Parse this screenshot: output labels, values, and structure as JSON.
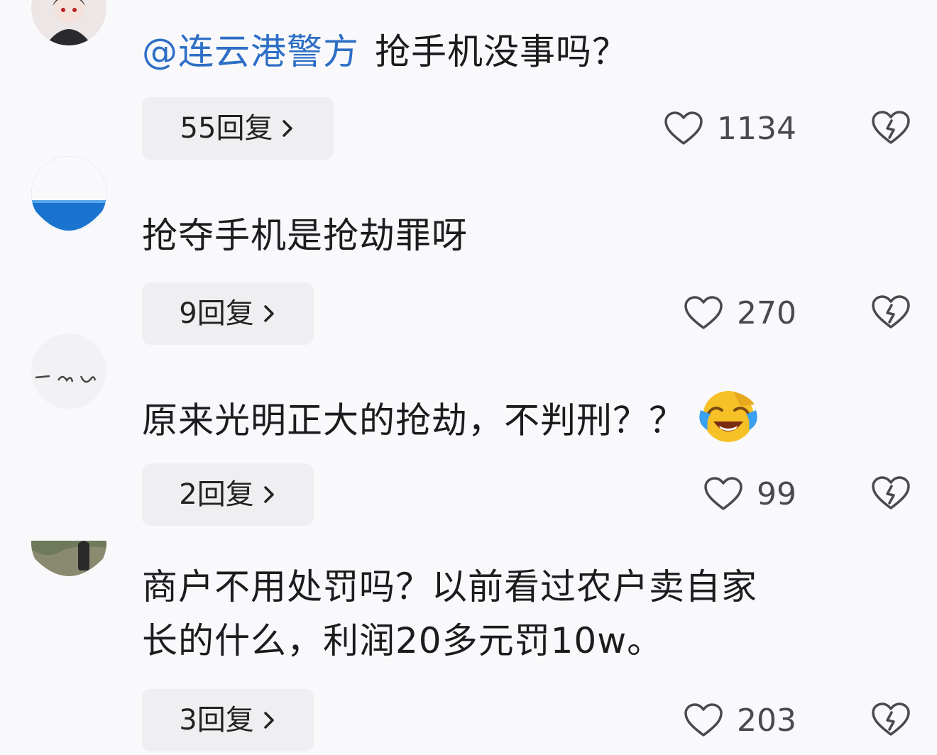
{
  "comments": [
    {
      "mention": "@连云港警方",
      "text": "抢手机没事吗？",
      "reply_label": "55回复",
      "likes": "1134",
      "avatar_icon": "user-avatar-icon"
    },
    {
      "text": "抢夺手机是抢劫罪呀",
      "reply_label": "9回复",
      "likes": "270",
      "avatar_icon": "user-avatar-icon"
    },
    {
      "text": "原来光明正大的抢劫，不判刑？？",
      "emoji": "laughing-crying-emoji",
      "reply_label": "2回复",
      "likes": "99",
      "avatar_icon": "user-avatar-icon"
    },
    {
      "text_line1": "商户不用处罚吗？以前看过农户卖自家",
      "text_line2": "长的什么，利润20多元罚10w。",
      "reply_label": "3回复",
      "likes": "203",
      "avatar_icon": "user-avatar-icon"
    }
  ],
  "colors": {
    "mention": "#2e6fc6",
    "pill_bg": "#efeff2",
    "icon_stroke": "#4a4a4e"
  },
  "icons": {
    "like": "heart-icon",
    "dislike": "broken-heart-icon",
    "reply_arrow": "chevron-right-icon"
  }
}
